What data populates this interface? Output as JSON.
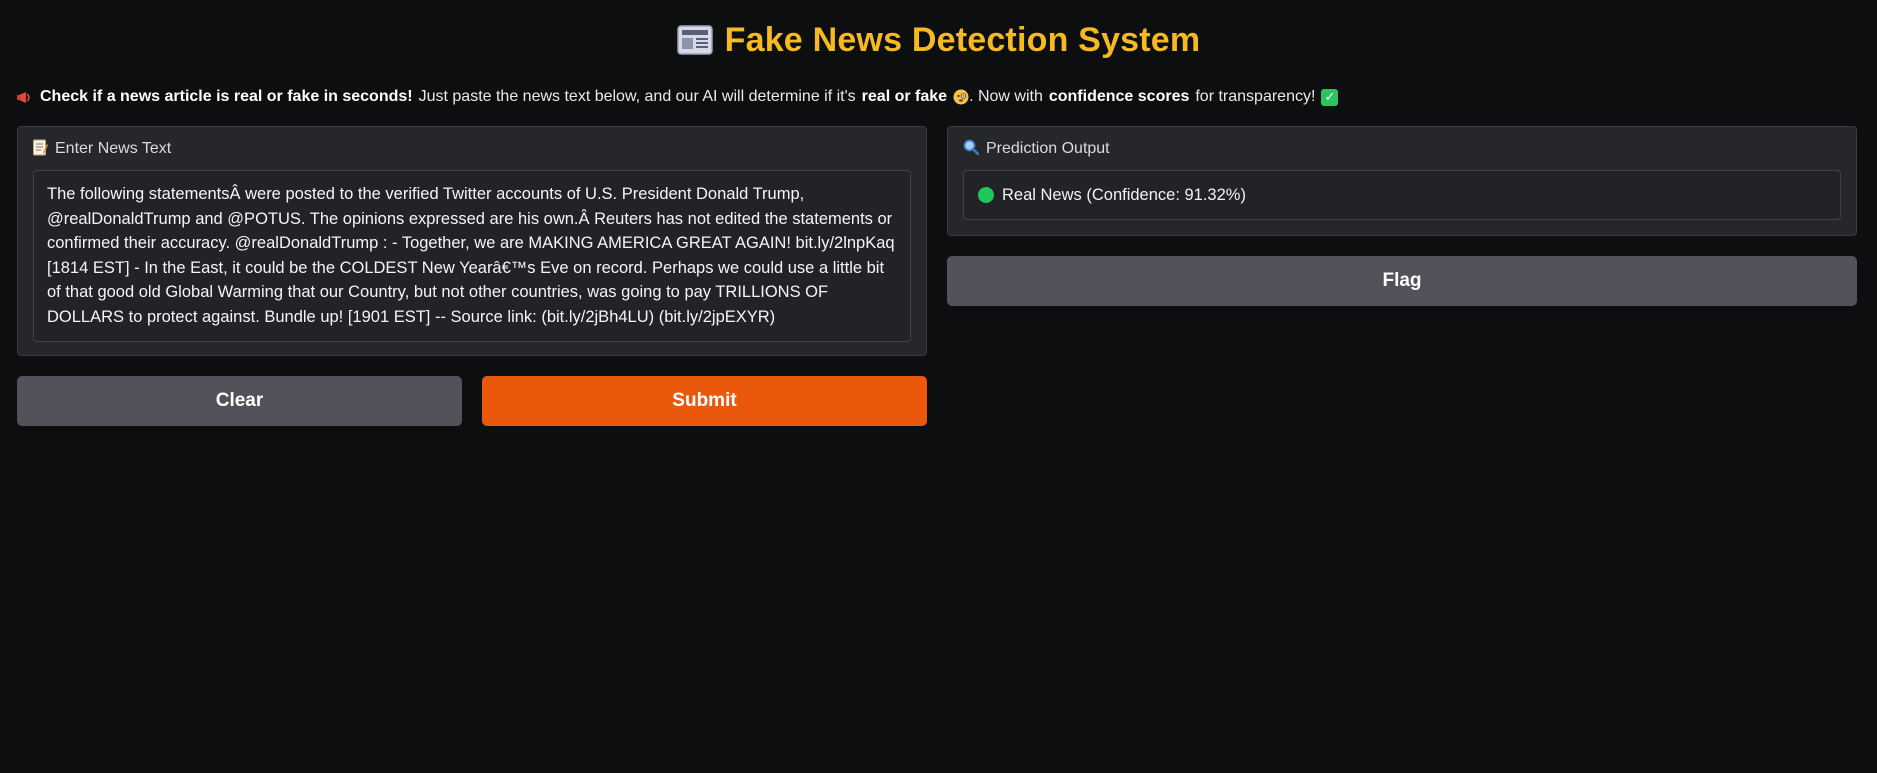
{
  "header": {
    "title_icon": "newspaper-icon",
    "title": "Fake News Detection System"
  },
  "description": {
    "megaphone_icon": "megaphone-icon",
    "bold_intro": "Check if a news article is real or fake in seconds!",
    "text_1": "Just paste the news text below, and our AI will determine if it's",
    "bold_real_fake": "real or fake",
    "thinking_icon": "face-with-monocle-icon",
    "text_2": ". Now with",
    "bold_confidence": "confidence scores",
    "text_3": "for transparency!",
    "check_icon": "check-mark-icon"
  },
  "input_panel": {
    "icon": "memo-icon",
    "label": "Enter News Text",
    "value": "The following statementsÂ were posted to the verified Twitter accounts of U.S. President Donald Trump, @realDonaldTrump and @POTUS. The opinions expressed are his own.Â Reuters has not edited the statements or confirmed their accuracy. @realDonaldTrump : - Together, we are MAKING AMERICA GREAT AGAIN! bit.ly/2lnpKaq [1814 EST] - In the East, it could be the COLDEST New Yearâ€™s Eve on record. Perhaps we could use a little bit of that good old Global Warming that our Country, but not other countries, was going to pay TRILLIONS OF DOLLARS to protect against. Bundle up! [1901 EST] -- Source link: (bit.ly/2jBh4LU) (bit.ly/2jpEXYR)"
  },
  "buttons": {
    "clear": "Clear",
    "submit": "Submit",
    "flag": "Flag"
  },
  "output_panel": {
    "icon": "magnifying-glass-icon",
    "label": "Prediction Output",
    "status_icon": "green-circle-icon",
    "result": "Real News (Confidence: 91.32%)"
  },
  "colors": {
    "title": "#f5b921",
    "primary_button": "#ea580c",
    "secondary_button": "#52535a",
    "status_green": "#1fc65c"
  }
}
